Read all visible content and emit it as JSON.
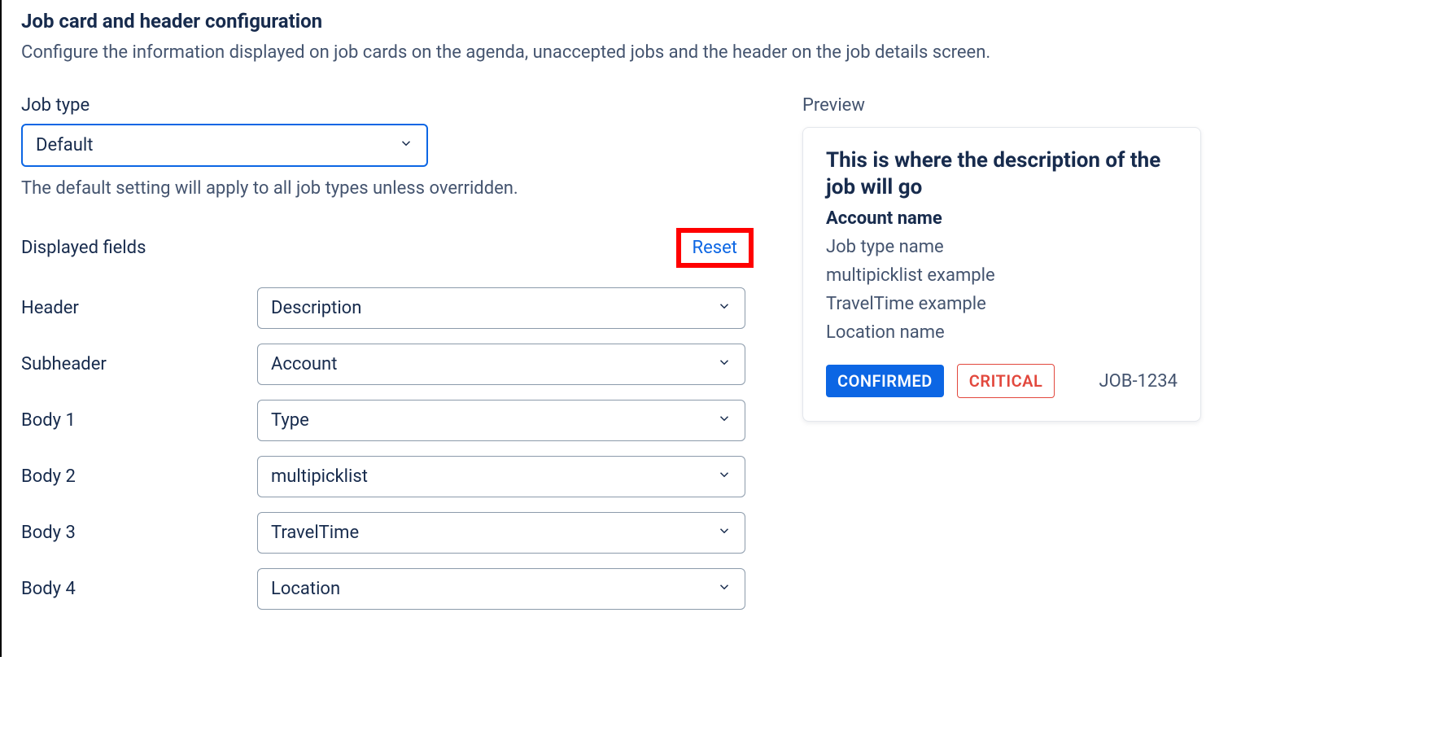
{
  "header": {
    "title": "Job card and header configuration",
    "subtitle": "Configure the information displayed on job cards on the agenda, unaccepted jobs and the header on the job details screen."
  },
  "jobType": {
    "label": "Job type",
    "value": "Default",
    "help": "The default setting will apply to all job types unless overridden."
  },
  "displayedFields": {
    "label": "Displayed fields",
    "reset": "Reset",
    "rows": [
      {
        "label": "Header",
        "value": "Description"
      },
      {
        "label": "Subheader",
        "value": "Account"
      },
      {
        "label": "Body 1",
        "value": "Type"
      },
      {
        "label": "Body 2",
        "value": "multipicklist"
      },
      {
        "label": "Body 3",
        "value": "TravelTime"
      },
      {
        "label": "Body 4",
        "value": "Location"
      }
    ]
  },
  "preview": {
    "label": "Preview",
    "description": "This is where the description of the job will go",
    "account": "Account name",
    "lines": [
      "Job type name",
      "multipicklist example",
      "TravelTime example",
      "Location name"
    ],
    "badges": {
      "confirmed": "CONFIRMED",
      "critical": "CRITICAL"
    },
    "jobId": "JOB-1234"
  }
}
